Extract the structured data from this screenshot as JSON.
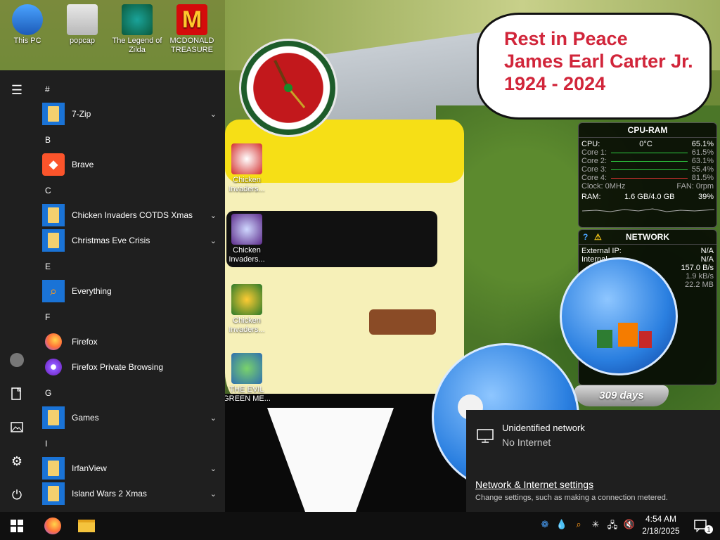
{
  "desktop": {
    "icons": [
      {
        "label": "This PC"
      },
      {
        "label": "popcap"
      },
      {
        "label": "The Legend of Zilda"
      },
      {
        "label": "MCDONALD TREASURE"
      },
      {
        "label": "Chicken Invaders..."
      },
      {
        "label": "Chicken Invaders..."
      },
      {
        "label": "Chicken Invaders..."
      },
      {
        "label": "THE EVIL GREEN ME..."
      }
    ],
    "bubble": {
      "line1": "Rest in Peace",
      "line2": "James Earl Carter Jr.",
      "line3": "1924 - 2024"
    },
    "globe_caption": "309 days"
  },
  "cpu_ram": {
    "title": "CPU-RAM",
    "cpu_label": "CPU:",
    "cpu_temp": "0°C",
    "cpu_value": "65.1%",
    "cores": [
      {
        "label": "Core 1:",
        "value": "61.5%",
        "fraction": 0.615
      },
      {
        "label": "Core 2:",
        "value": "63.1%",
        "fraction": 0.631
      },
      {
        "label": "Core 3:",
        "value": "55.4%",
        "fraction": 0.554
      },
      {
        "label": "Core 4:",
        "value": "81.5%",
        "fraction": 0.815
      }
    ],
    "clock": "Clock: 0MHz",
    "fan": "FAN: 0rpm",
    "ram_label": "RAM:",
    "ram_value": "1.6 GB/4.0 GB",
    "ram_pct": "39%"
  },
  "network": {
    "title": "NETWORK",
    "external_ip_label": "External IP:",
    "external_ip": "N/A",
    "internal_label": "Internal",
    "internal_value": "N/A",
    "speed": "157.0 B/s",
    "up": "1.9 kB/s",
    "total": "22.2 MB"
  },
  "start_menu": {
    "sections": [
      {
        "header": "#",
        "apps": [
          {
            "label": "7-Zip",
            "expandable": true,
            "icon": "folder-icon"
          }
        ]
      },
      {
        "header": "B",
        "apps": [
          {
            "label": "Brave",
            "expandable": false,
            "icon": "brave-icon"
          }
        ]
      },
      {
        "header": "C",
        "apps": [
          {
            "label": "Chicken Invaders COTDS Xmas",
            "expandable": true,
            "icon": "folder-icon"
          },
          {
            "label": "Christmas Eve Crisis",
            "expandable": true,
            "icon": "folder-icon"
          }
        ]
      },
      {
        "header": "E",
        "apps": [
          {
            "label": "Everything",
            "expandable": false,
            "icon": "search-icon"
          }
        ]
      },
      {
        "header": "F",
        "apps": [
          {
            "label": "Firefox",
            "expandable": false,
            "icon": "firefox-icon"
          },
          {
            "label": "Firefox Private Browsing",
            "expandable": false,
            "icon": "firefox-private-icon"
          }
        ]
      },
      {
        "header": "G",
        "apps": [
          {
            "label": "Games",
            "expandable": true,
            "icon": "folder-icon"
          }
        ]
      },
      {
        "header": "I",
        "apps": [
          {
            "label": "IrfanView",
            "expandable": true,
            "icon": "folder-icon"
          },
          {
            "label": "Island Wars 2 Xmas",
            "expandable": true,
            "icon": "folder-icon"
          }
        ]
      }
    ]
  },
  "network_flyout": {
    "title": "Unidentified network",
    "status": "No Internet",
    "link": "Network & Internet settings",
    "description": "Change settings, such as making a connection metered."
  },
  "taskbar": {
    "time": "4:54 AM",
    "date": "2/18/2025",
    "notification_count": "1"
  },
  "colors": {
    "bubble_text": "#d1253a",
    "start_bg": "#1f1f1f",
    "taskbar_bg": "#101010",
    "link": "#ffffff",
    "graph_green": "#2ecc40"
  }
}
